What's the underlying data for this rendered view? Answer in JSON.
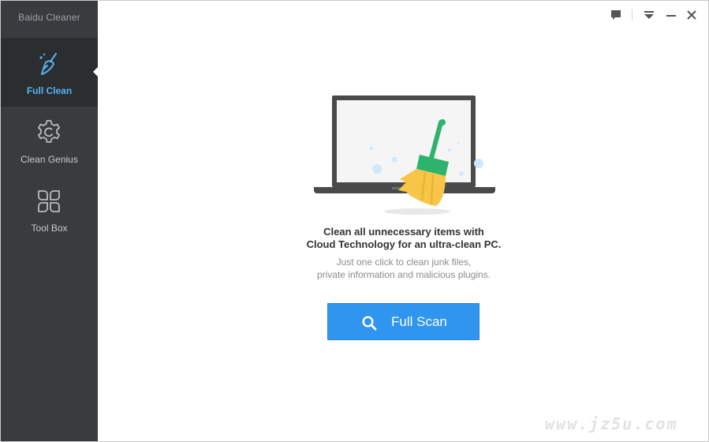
{
  "app": {
    "title": "Baidu Cleaner"
  },
  "sidebar": {
    "items": [
      {
        "label": "Full Clean",
        "icon": "broom-icon",
        "active": true
      },
      {
        "label": "Clean Genius",
        "icon": "gear-icon",
        "active": false
      },
      {
        "label": "Tool Box",
        "icon": "grid-icon",
        "active": false
      }
    ]
  },
  "titlebar": {
    "icons": [
      "feedback-icon",
      "menu-icon",
      "minimize-icon",
      "close-icon"
    ]
  },
  "main": {
    "headline_line1": "Clean all unnecessary items with",
    "headline_line2": "Cloud Technology for an ultra-clean PC.",
    "subline_line1": "Just one click to clean junk files,",
    "subline_line2": "private information and malicious plugins.",
    "scan_button_label": "Full Scan"
  },
  "watermark": {
    "text": "www.jz5u.com"
  },
  "colors": {
    "sidebar_bg": "#393c3f",
    "sidebar_active_bg": "#2b2e31",
    "accent_blue": "#2f95ef",
    "active_label": "#57b2f2",
    "broom_handle": "#2db36b",
    "broom_head": "#f7c547"
  }
}
